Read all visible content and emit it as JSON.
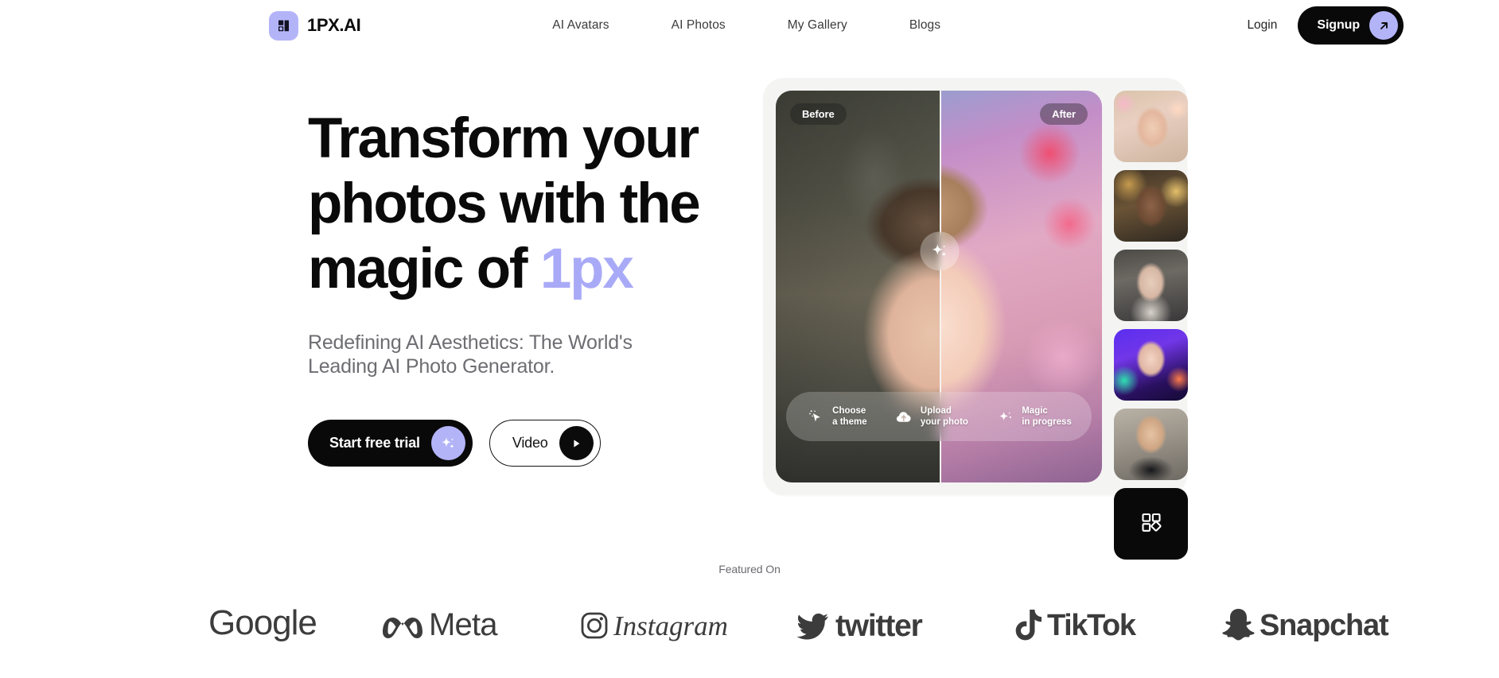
{
  "brand": {
    "name": "1PX.AI",
    "logo_icon": "pixel-logo-icon",
    "accent_color": "#b3b4f8"
  },
  "header": {
    "nav": [
      {
        "label": "AI Avatars"
      },
      {
        "label": "AI Photos"
      },
      {
        "label": "My Gallery"
      },
      {
        "label": "Blogs"
      }
    ],
    "login_label": "Login",
    "signup_label": "Signup",
    "signup_icon": "arrow-up-right-icon"
  },
  "hero": {
    "headline_part1": "Transform your photos with the magic of ",
    "headline_accent": "1px",
    "subhead": "Redefining AI Aesthetics: The World's Leading AI Photo Generator.",
    "primary_cta": {
      "label": "Start free trial",
      "icon": "sparkle-icon"
    },
    "secondary_cta": {
      "label": "Video",
      "icon": "play-icon"
    }
  },
  "showcase": {
    "before_label": "Before",
    "after_label": "After",
    "slider_icon": "sparkle-icon",
    "steps": [
      {
        "icon": "cursor-sparkle-icon",
        "line1": "Choose",
        "line2": "a theme"
      },
      {
        "icon": "cloud-upload-icon",
        "line1": "Upload",
        "line2": "your photo"
      },
      {
        "icon": "sparkle-icon",
        "line1": "Magic",
        "line2": "in progress"
      }
    ],
    "thumbnails": [
      {
        "name": "thumbnail-floral-portrait"
      },
      {
        "name": "thumbnail-golden-portrait"
      },
      {
        "name": "thumbnail-bridal-portrait"
      },
      {
        "name": "thumbnail-neon-portrait"
      },
      {
        "name": "thumbnail-male-portrait"
      }
    ],
    "more_tile": {
      "icon": "grid-icon",
      "name": "view-all-tile"
    }
  },
  "featured": {
    "label": "Featured On",
    "logos": [
      {
        "name": "google-logo",
        "text": "Google"
      },
      {
        "name": "meta-logo",
        "text": "Meta"
      },
      {
        "name": "instagram-logo",
        "text": "Instagram"
      },
      {
        "name": "twitter-logo",
        "text": "twitter"
      },
      {
        "name": "tiktok-logo",
        "text": "TikTok"
      },
      {
        "name": "snapchat-logo",
        "text": "Snapchat"
      }
    ]
  }
}
